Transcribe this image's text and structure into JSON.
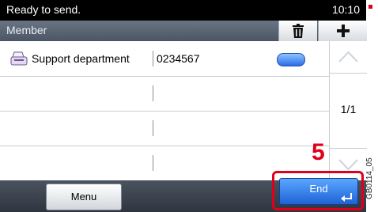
{
  "statusbar": {
    "message": "Ready to send.",
    "time": "10:10"
  },
  "header": {
    "title": "Member",
    "trash_icon": "trash-icon",
    "add_icon": "plus-icon"
  },
  "list": {
    "rows": [
      {
        "name": "Support department",
        "number": "0234567",
        "icon": "fax-machine-icon",
        "detail_icon": "more-oval-icon"
      },
      {
        "name": "",
        "number": ""
      },
      {
        "name": "",
        "number": ""
      },
      {
        "name": "",
        "number": ""
      }
    ]
  },
  "scroll": {
    "page": "1/1"
  },
  "footer": {
    "menu_label": "Menu",
    "end_label": "End"
  },
  "annotation": {
    "step": "5",
    "code": "GB0114_05"
  },
  "colors": {
    "accent_blue": "#2a6ee8",
    "highlight_red": "#e0001a"
  }
}
